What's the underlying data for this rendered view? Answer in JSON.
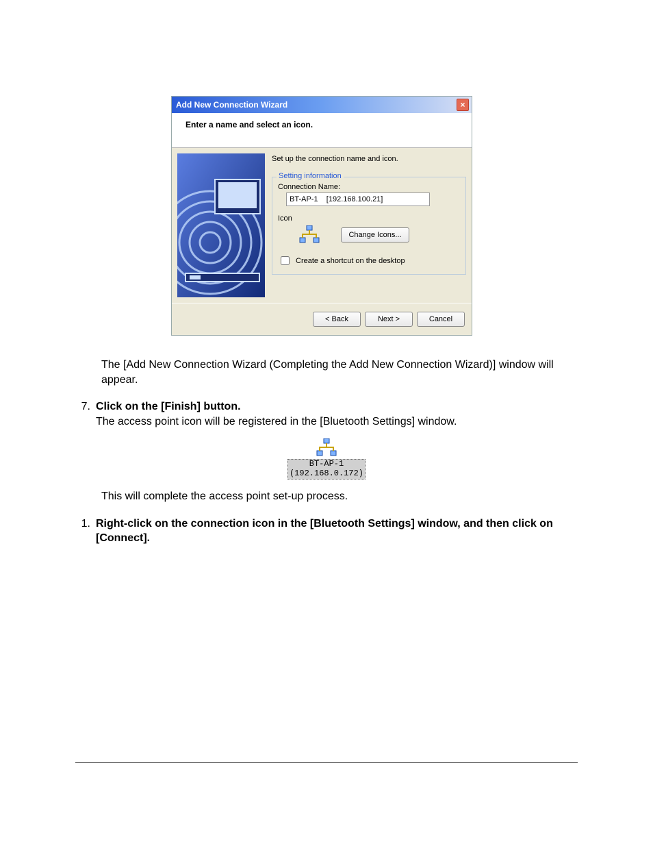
{
  "dialog": {
    "title": "Add New Connection Wizard",
    "header": "Enter a name and select an icon.",
    "instruction": "Set up the connection name and icon.",
    "fieldset_legend": "Setting information",
    "conn_label": "Connection Name:",
    "conn_value": "BT-AP-1    [192.168.100.21]",
    "icon_label": "Icon",
    "change_icons": "Change Icons...",
    "shortcut_label": "Create a shortcut on the desktop",
    "buttons": {
      "back": "< Back",
      "next": "Next >",
      "cancel": "Cancel"
    }
  },
  "doc": {
    "p1": "The [Add New Connection Wizard (Completing the Add New Connection Wizard)] window will appear.",
    "step7_num": "7.",
    "step7_bold": "Click on the [Finish] button.",
    "step7_body": "The access point icon will be registered in the [Bluetooth Settings] window.",
    "reg_name": "BT-AP-1",
    "reg_ip": "(192.168.0.172)",
    "p2": "This will complete the access point set-up process.",
    "step1_num": "1.",
    "step1_bold": "Right-click on the connection icon in the [Bluetooth Settings] window, and then click on [Connect]."
  }
}
